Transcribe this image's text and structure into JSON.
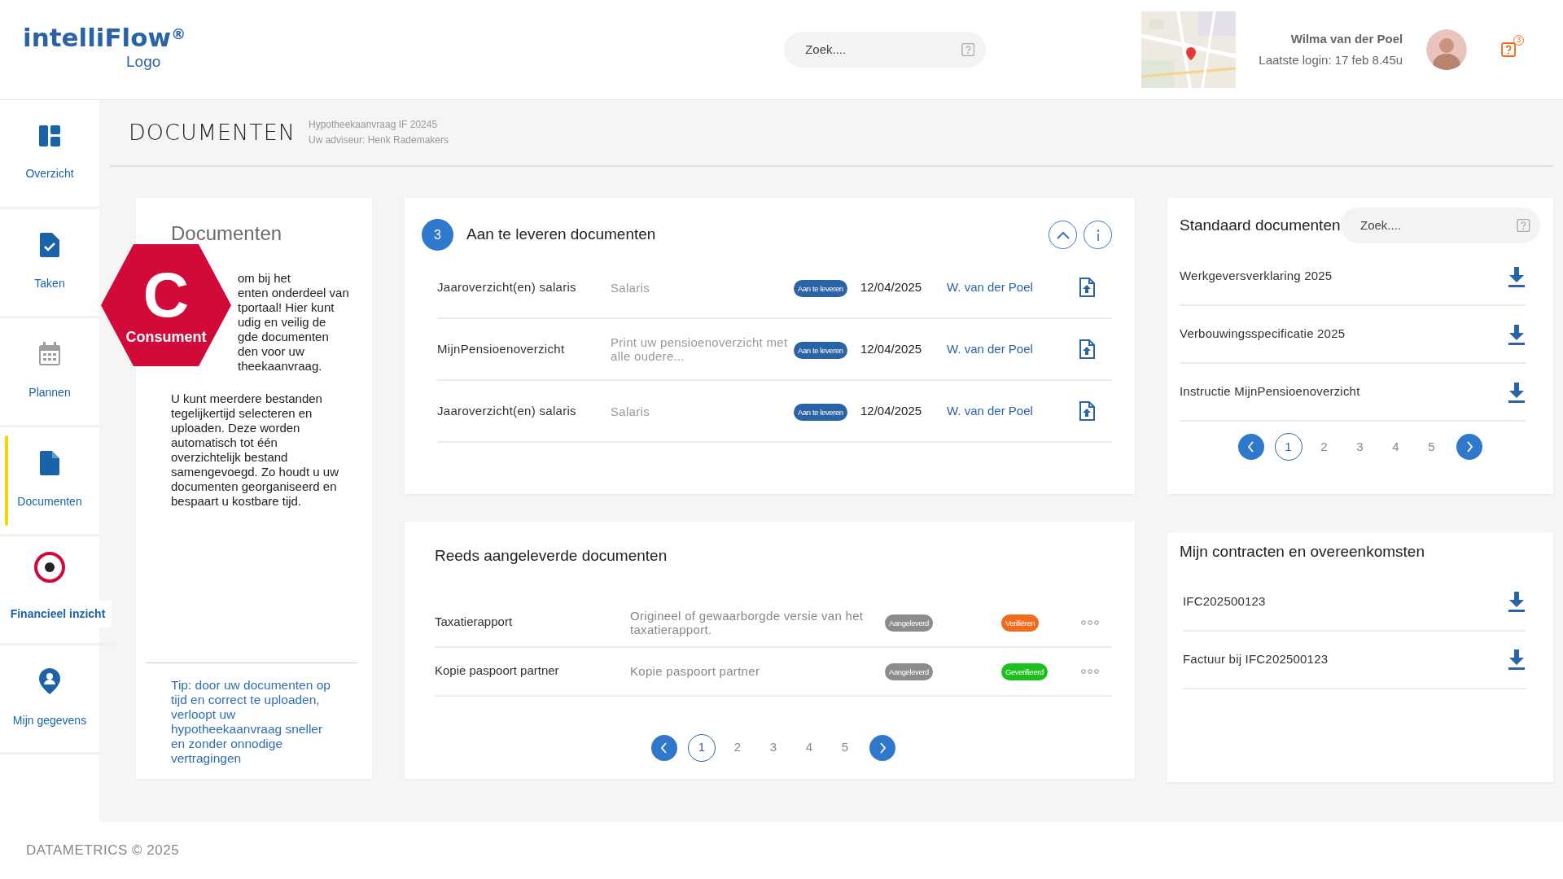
{
  "header": {
    "logo": "intelliFlow$^{®}$",
    "logo_subtitle": "Logo",
    "search": {
      "placeholder": "Zoek...."
    },
    "user": {
      "name": "Wilma van der Poel",
      "last_login": "Laatste login: 17 feb 8.45u"
    },
    "help_badge": "3"
  },
  "sidebar": {
    "items": [
      {
        "label": "Overzicht",
        "selected": false
      },
      {
        "label": "Taken",
        "selected": false
      },
      {
        "label": "Plannen",
        "selected": false
      },
      {
        "label": "Documenten",
        "selected": true
      },
      {
        "label": "Financieel inzicht",
        "selected": false
      },
      {
        "label": "Mijn gegevens",
        "selected": false
      }
    ]
  },
  "page": {
    "title": "DOCUMENTEN",
    "subtitle_lines": [
      "Hypotheekaanvraag IF 20245",
      "Uw adviseur: Henk Rademakers"
    ]
  },
  "info_card": {
    "title": "Documenten",
    "intro_visible_lines": [
      "om bij het",
      "enten onderdeel van",
      "tportaal! Hier kunt",
      "udig en veilig de",
      "gde documenten",
      "den voor uw",
      "theekaanvraag."
    ],
    "paragraph": "U kunt meerdere bestanden tegelijkertijd selecteren en uploaden. Deze worden automatisch tot één overzichtelijk bestand samengevoegd. Zo houdt u uw documenten georganiseerd en bespaart u kostbare tijd.",
    "tip": "Tip: door uw documenten op tijd en correct te uploaden, verloopt uw hypotheekaanvraag sneller en zonder onnodige vertragingen"
  },
  "badge": {
    "letter": "C",
    "label": "Consument"
  },
  "pending": {
    "count": "3",
    "title": "Aan te leveren documenten",
    "rows": [
      {
        "name": "Jaaroverzicht(en) salaris",
        "description": "Salaris",
        "status": {
          "label": "Aan te leveren",
          "color": "#2a64a6"
        },
        "date": "12/04/2025",
        "person": "W. van der Poel"
      },
      {
        "name": "MijnPensioenoverzicht",
        "description": "Print uw pensioenoverzicht met alle oudere...",
        "status": {
          "label": "Aan te leveren",
          "color": "#2a64a6"
        },
        "date": "12/04/2025",
        "person": "W. van der Poel"
      },
      {
        "name": "Jaaroverzicht(en) salaris",
        "description": "Salaris",
        "status": {
          "label": "Aan te leveren",
          "color": "#2a64a6"
        },
        "date": "12/04/2025",
        "person": "W. van der Poel"
      }
    ]
  },
  "delivered": {
    "title": "Reeds aangeleverde documenten",
    "rows": [
      {
        "name": "Taxatierapport",
        "description": "Origineel of gewaarborgde versie van het taxatierapport.",
        "status": {
          "label": "Aangeleverd",
          "color": "#8c8c8c"
        },
        "review": {
          "label": "Verifiëren",
          "color": "#f26a1b"
        }
      },
      {
        "name": "Kopie paspoort partner",
        "description": "Kopie paspoort partner",
        "status": {
          "label": "Aangeleverd",
          "color": "#8c8c8c"
        },
        "review": {
          "label": "Geverifieerd",
          "color": "#1dbf1d"
        }
      }
    ],
    "pagination": [
      {
        "label": "1",
        "selected": true
      },
      {
        "label": "2",
        "selected": false
      },
      {
        "label": "3",
        "selected": false
      },
      {
        "label": "4",
        "selected": false
      },
      {
        "label": "5",
        "selected": false
      }
    ]
  },
  "standard": {
    "title": "Standaard documenten",
    "search": {
      "placeholder": "Zoek...."
    },
    "items": [
      "Werkgeversverklaring 2025",
      "Verbouwingsspecificatie 2025",
      "Instructie MijnPensioenoverzicht"
    ],
    "pagination": [
      {
        "label": "1",
        "selected": true
      },
      {
        "label": "2",
        "selected": false
      },
      {
        "label": "3",
        "selected": false
      },
      {
        "label": "4",
        "selected": false
      },
      {
        "label": "5",
        "selected": false
      }
    ]
  },
  "contracts": {
    "title": "Mijn contracten en overeenkomsten",
    "items": [
      "IFC202500123",
      "Factuur bij IFC202500123"
    ]
  },
  "footer": "DATAMETRICS © 2025"
}
